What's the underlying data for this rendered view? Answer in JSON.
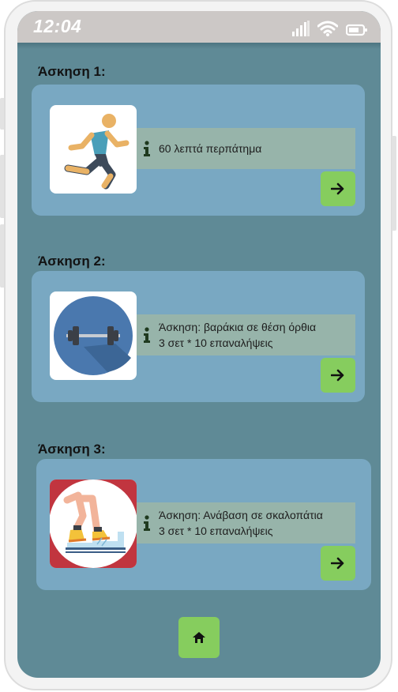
{
  "status_bar": {
    "time": "12:04",
    "icons": [
      "signal-icon",
      "wifi-icon",
      "battery-icon"
    ]
  },
  "exercises": [
    {
      "title": "Άσκηση 1:",
      "image": "running-person-icon",
      "info_lines": [
        "60 λεπτά περπάτημα"
      ],
      "action": "arrow-right-icon"
    },
    {
      "title": "Άσκηση 2:",
      "image": "dumbbell-icon",
      "info_lines": [
        "Άσκηση: βαράκια σε θέση όρθια",
        "3 σετ * 10 επαναλήψεις"
      ],
      "action": "arrow-right-icon"
    },
    {
      "title": "Άσκηση 3:",
      "image": "step-up-stairs-icon",
      "info_lines": [
        "Άσκηση: Ανάβαση σε σκαλοπάτια",
        "3 σετ * 10 επαναλήψεις"
      ],
      "action": "arrow-right-icon"
    }
  ],
  "footer": {
    "home_icon": "home-icon"
  },
  "colors": {
    "screen_background": "#5f8a96",
    "card_background": "#79a8c2",
    "info_background": "#97b4aa",
    "button_green": "#86cd5e",
    "status_bar": "#ccc8c6"
  }
}
